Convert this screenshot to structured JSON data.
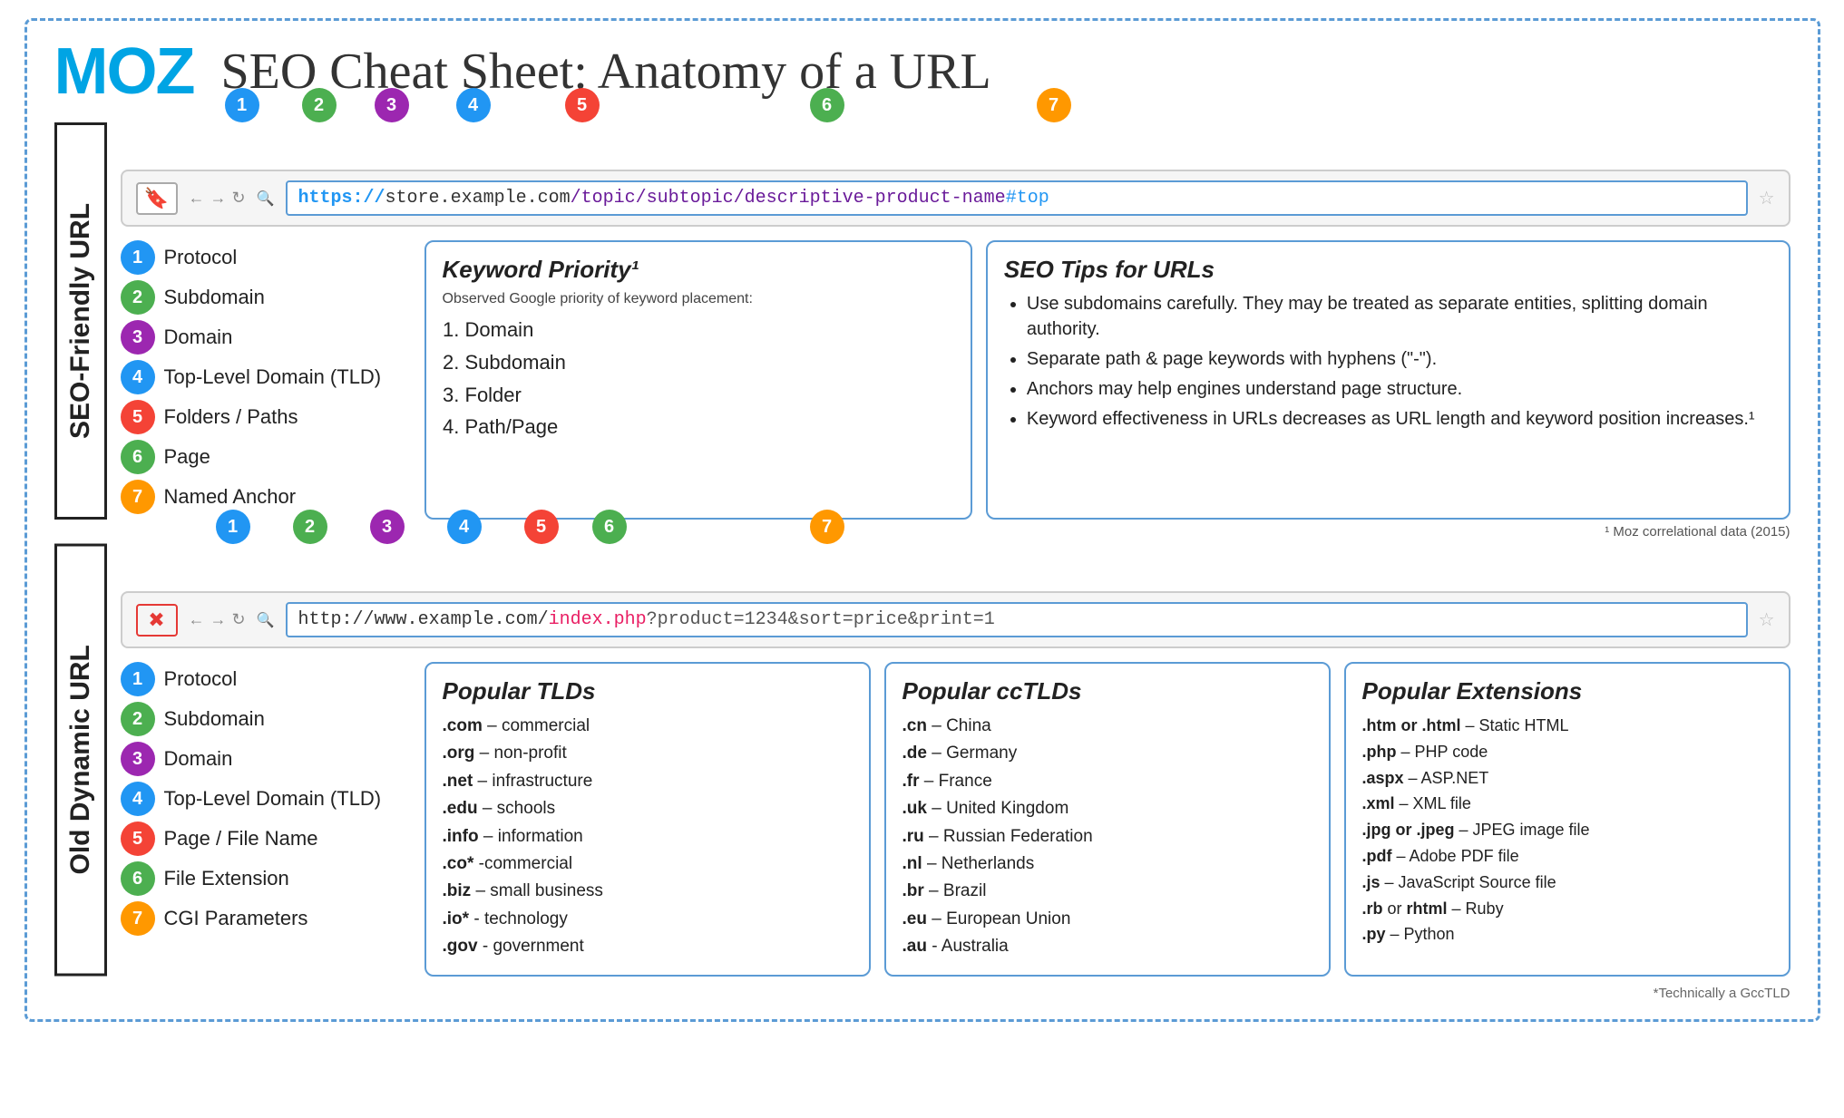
{
  "header": {
    "logo": "MOZ",
    "title": "SEO Cheat Sheet: Anatomy of a URL"
  },
  "seo_section": {
    "label": "SEO-Friendly URL",
    "url": {
      "full": "https://store.example.com/topic/subtopic/descriptive-product-name#top",
      "parts": {
        "https": "https://",
        "store": "store",
        "dot1": ".",
        "example": "example",
        "dot2": ".",
        "com": "com",
        "path": "/topic/subtopic/descriptive-product-name",
        "anchor": "#top"
      }
    },
    "items": [
      {
        "badge": "1",
        "text": "Protocol"
      },
      {
        "badge": "2",
        "text": "Subdomain"
      },
      {
        "badge": "3",
        "text": "Domain"
      },
      {
        "badge": "4",
        "text": "Top-Level Domain (TLD)"
      },
      {
        "badge": "5",
        "text": "Folders / Paths"
      },
      {
        "badge": "6",
        "text": "Page"
      },
      {
        "badge": "7",
        "text": "Named Anchor"
      }
    ],
    "keyword_box": {
      "title": "Keyword Priority¹",
      "subtitle": "Observed Google priority of keyword placement:",
      "items": [
        "Domain",
        "Subdomain",
        "Folder",
        "Path/Page"
      ]
    },
    "seo_tips_box": {
      "title": "SEO Tips for URLs",
      "tips": [
        "Use subdomains carefully. They may be treated as separate entities, splitting domain authority.",
        "Separate path & page keywords with hyphens (\"-\").",
        "Anchors may help engines understand page structure.",
        "Keyword effectiveness in URLs decreases as URL length and keyword position increases.¹"
      ]
    }
  },
  "footnote": "¹ Moz correlational data (2015)",
  "dynamic_section": {
    "label": "Old Dynamic URL",
    "url": {
      "full": "http://www.example.com/index.php?product=1234&sort=price&print=1",
      "parts": {
        "http": "http://",
        "www": "www",
        "dot1": ".",
        "example": "example",
        "dot2": ".",
        "com": "com",
        "slash": "/",
        "index": "index",
        "php": ".php",
        "query": "?product=1234&sort=price&print=1"
      }
    },
    "items": [
      {
        "badge": "1",
        "text": "Protocol"
      },
      {
        "badge": "2",
        "text": "Subdomain"
      },
      {
        "badge": "3",
        "text": "Domain"
      },
      {
        "badge": "4",
        "text": "Top-Level Domain (TLD)"
      },
      {
        "badge": "5",
        "text": "Page / File Name"
      },
      {
        "badge": "6",
        "text": "File Extension"
      },
      {
        "badge": "7",
        "text": "CGI Parameters"
      }
    ],
    "tlds_box": {
      "title": "Popular TLDs",
      "items": [
        {
          ".com": ".com",
          "desc": "commercial"
        },
        {
          ".com": ".org",
          "desc": "non-profit"
        },
        {
          ".com": ".net",
          "desc": "infrastructure"
        },
        {
          ".com": ".edu",
          "desc": "schools"
        },
        {
          ".com": ".info",
          "desc": "information"
        },
        {
          ".com": ".co*",
          "desc": "commercial"
        },
        {
          ".com": ".biz",
          "desc": "small business"
        },
        {
          ".com": ".io*",
          "desc": "technology"
        },
        {
          ".com": ".gov",
          "desc": "government"
        }
      ],
      "entries": [
        [
          ".com",
          "commercial"
        ],
        [
          ".org",
          "non-profit"
        ],
        [
          ".net",
          "infrastructure"
        ],
        [
          ".edu",
          "schools"
        ],
        [
          ".info",
          "information"
        ],
        [
          ".co*",
          "commercial"
        ],
        [
          ".biz",
          "small business"
        ],
        [
          ".io*",
          "technology"
        ],
        [
          ".gov",
          "government"
        ]
      ]
    },
    "cctlds_box": {
      "title": "Popular ccTLDs",
      "entries": [
        [
          ".cn",
          "China"
        ],
        [
          ".de",
          "Germany"
        ],
        [
          ".fr",
          "France"
        ],
        [
          ".uk",
          "United Kingdom"
        ],
        [
          ".ru",
          "Russian Federation"
        ],
        [
          ".nl",
          "Netherlands"
        ],
        [
          ".br",
          "Brazil"
        ],
        [
          ".eu",
          "European Union"
        ],
        [
          ".au",
          "Australia"
        ]
      ]
    },
    "extensions_box": {
      "title": "Popular Extensions",
      "entries": [
        [
          ".htm or .html",
          "Static HTML"
        ],
        [
          ".php",
          "PHP code"
        ],
        [
          ".aspx",
          "ASP.NET"
        ],
        [
          ".xml",
          "XML file"
        ],
        [
          ".jpg or .jpeg",
          "JPEG image file"
        ],
        [
          ".pdf",
          "Adobe PDF file"
        ],
        [
          ".js",
          "JavaScript Source file"
        ],
        [
          ".rb or rhtml",
          "Ruby"
        ],
        [
          ".py",
          "Python"
        ]
      ]
    }
  },
  "bottom_note": "*Technically a GccTLD",
  "badge_colors": {
    "1": "#2196f3",
    "2": "#4caf50",
    "3": "#9c27b0",
    "4": "#2196f3",
    "5": "#f44336",
    "6": "#4caf50",
    "7": "#ff9800"
  }
}
